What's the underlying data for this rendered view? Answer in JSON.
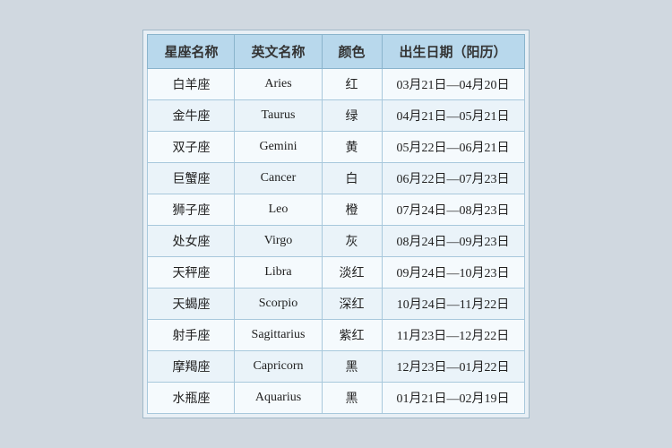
{
  "table": {
    "headers": [
      "星座名称",
      "英文名称",
      "颜色",
      "出生日期（阳历）"
    ],
    "rows": [
      [
        "白羊座",
        "Aries",
        "红",
        "03月21日—04月20日"
      ],
      [
        "金牛座",
        "Taurus",
        "绿",
        "04月21日—05月21日"
      ],
      [
        "双子座",
        "Gemini",
        "黄",
        "05月22日—06月21日"
      ],
      [
        "巨蟹座",
        "Cancer",
        "白",
        "06月22日—07月23日"
      ],
      [
        "狮子座",
        "Leo",
        "橙",
        "07月24日—08月23日"
      ],
      [
        "处女座",
        "Virgo",
        "灰",
        "08月24日—09月23日"
      ],
      [
        "天秤座",
        "Libra",
        "淡红",
        "09月24日—10月23日"
      ],
      [
        "天蝎座",
        "Scorpio",
        "深红",
        "10月24日—11月22日"
      ],
      [
        "射手座",
        "Sagittarius",
        "紫红",
        "11月23日—12月22日"
      ],
      [
        "摩羯座",
        "Capricorn",
        "黑",
        "12月23日—01月22日"
      ],
      [
        "水瓶座",
        "Aquarius",
        "黑",
        "01月21日—02月19日"
      ]
    ]
  }
}
